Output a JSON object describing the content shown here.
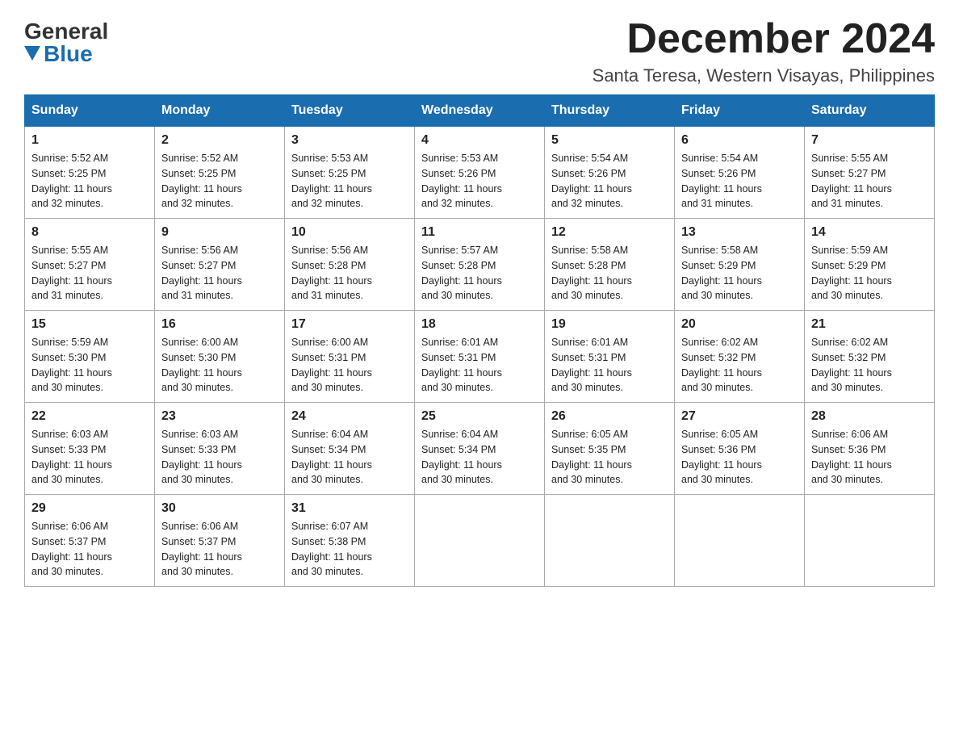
{
  "header": {
    "logo_general": "General",
    "logo_blue": "Blue",
    "month_title": "December 2024",
    "location": "Santa Teresa, Western Visayas, Philippines"
  },
  "days_of_week": [
    "Sunday",
    "Monday",
    "Tuesday",
    "Wednesday",
    "Thursday",
    "Friday",
    "Saturday"
  ],
  "weeks": [
    [
      {
        "day": "1",
        "sunrise": "5:52 AM",
        "sunset": "5:25 PM",
        "daylight": "11 hours and 32 minutes."
      },
      {
        "day": "2",
        "sunrise": "5:52 AM",
        "sunset": "5:25 PM",
        "daylight": "11 hours and 32 minutes."
      },
      {
        "day": "3",
        "sunrise": "5:53 AM",
        "sunset": "5:25 PM",
        "daylight": "11 hours and 32 minutes."
      },
      {
        "day": "4",
        "sunrise": "5:53 AM",
        "sunset": "5:26 PM",
        "daylight": "11 hours and 32 minutes."
      },
      {
        "day": "5",
        "sunrise": "5:54 AM",
        "sunset": "5:26 PM",
        "daylight": "11 hours and 32 minutes."
      },
      {
        "day": "6",
        "sunrise": "5:54 AM",
        "sunset": "5:26 PM",
        "daylight": "11 hours and 31 minutes."
      },
      {
        "day": "7",
        "sunrise": "5:55 AM",
        "sunset": "5:27 PM",
        "daylight": "11 hours and 31 minutes."
      }
    ],
    [
      {
        "day": "8",
        "sunrise": "5:55 AM",
        "sunset": "5:27 PM",
        "daylight": "11 hours and 31 minutes."
      },
      {
        "day": "9",
        "sunrise": "5:56 AM",
        "sunset": "5:27 PM",
        "daylight": "11 hours and 31 minutes."
      },
      {
        "day": "10",
        "sunrise": "5:56 AM",
        "sunset": "5:28 PM",
        "daylight": "11 hours and 31 minutes."
      },
      {
        "day": "11",
        "sunrise": "5:57 AM",
        "sunset": "5:28 PM",
        "daylight": "11 hours and 30 minutes."
      },
      {
        "day": "12",
        "sunrise": "5:58 AM",
        "sunset": "5:28 PM",
        "daylight": "11 hours and 30 minutes."
      },
      {
        "day": "13",
        "sunrise": "5:58 AM",
        "sunset": "5:29 PM",
        "daylight": "11 hours and 30 minutes."
      },
      {
        "day": "14",
        "sunrise": "5:59 AM",
        "sunset": "5:29 PM",
        "daylight": "11 hours and 30 minutes."
      }
    ],
    [
      {
        "day": "15",
        "sunrise": "5:59 AM",
        "sunset": "5:30 PM",
        "daylight": "11 hours and 30 minutes."
      },
      {
        "day": "16",
        "sunrise": "6:00 AM",
        "sunset": "5:30 PM",
        "daylight": "11 hours and 30 minutes."
      },
      {
        "day": "17",
        "sunrise": "6:00 AM",
        "sunset": "5:31 PM",
        "daylight": "11 hours and 30 minutes."
      },
      {
        "day": "18",
        "sunrise": "6:01 AM",
        "sunset": "5:31 PM",
        "daylight": "11 hours and 30 minutes."
      },
      {
        "day": "19",
        "sunrise": "6:01 AM",
        "sunset": "5:31 PM",
        "daylight": "11 hours and 30 minutes."
      },
      {
        "day": "20",
        "sunrise": "6:02 AM",
        "sunset": "5:32 PM",
        "daylight": "11 hours and 30 minutes."
      },
      {
        "day": "21",
        "sunrise": "6:02 AM",
        "sunset": "5:32 PM",
        "daylight": "11 hours and 30 minutes."
      }
    ],
    [
      {
        "day": "22",
        "sunrise": "6:03 AM",
        "sunset": "5:33 PM",
        "daylight": "11 hours and 30 minutes."
      },
      {
        "day": "23",
        "sunrise": "6:03 AM",
        "sunset": "5:33 PM",
        "daylight": "11 hours and 30 minutes."
      },
      {
        "day": "24",
        "sunrise": "6:04 AM",
        "sunset": "5:34 PM",
        "daylight": "11 hours and 30 minutes."
      },
      {
        "day": "25",
        "sunrise": "6:04 AM",
        "sunset": "5:34 PM",
        "daylight": "11 hours and 30 minutes."
      },
      {
        "day": "26",
        "sunrise": "6:05 AM",
        "sunset": "5:35 PM",
        "daylight": "11 hours and 30 minutes."
      },
      {
        "day": "27",
        "sunrise": "6:05 AM",
        "sunset": "5:36 PM",
        "daylight": "11 hours and 30 minutes."
      },
      {
        "day": "28",
        "sunrise": "6:06 AM",
        "sunset": "5:36 PM",
        "daylight": "11 hours and 30 minutes."
      }
    ],
    [
      {
        "day": "29",
        "sunrise": "6:06 AM",
        "sunset": "5:37 PM",
        "daylight": "11 hours and 30 minutes."
      },
      {
        "day": "30",
        "sunrise": "6:06 AM",
        "sunset": "5:37 PM",
        "daylight": "11 hours and 30 minutes."
      },
      {
        "day": "31",
        "sunrise": "6:07 AM",
        "sunset": "5:38 PM",
        "daylight": "11 hours and 30 minutes."
      },
      null,
      null,
      null,
      null
    ]
  ],
  "labels": {
    "sunrise": "Sunrise:",
    "sunset": "Sunset:",
    "daylight": "Daylight:"
  }
}
